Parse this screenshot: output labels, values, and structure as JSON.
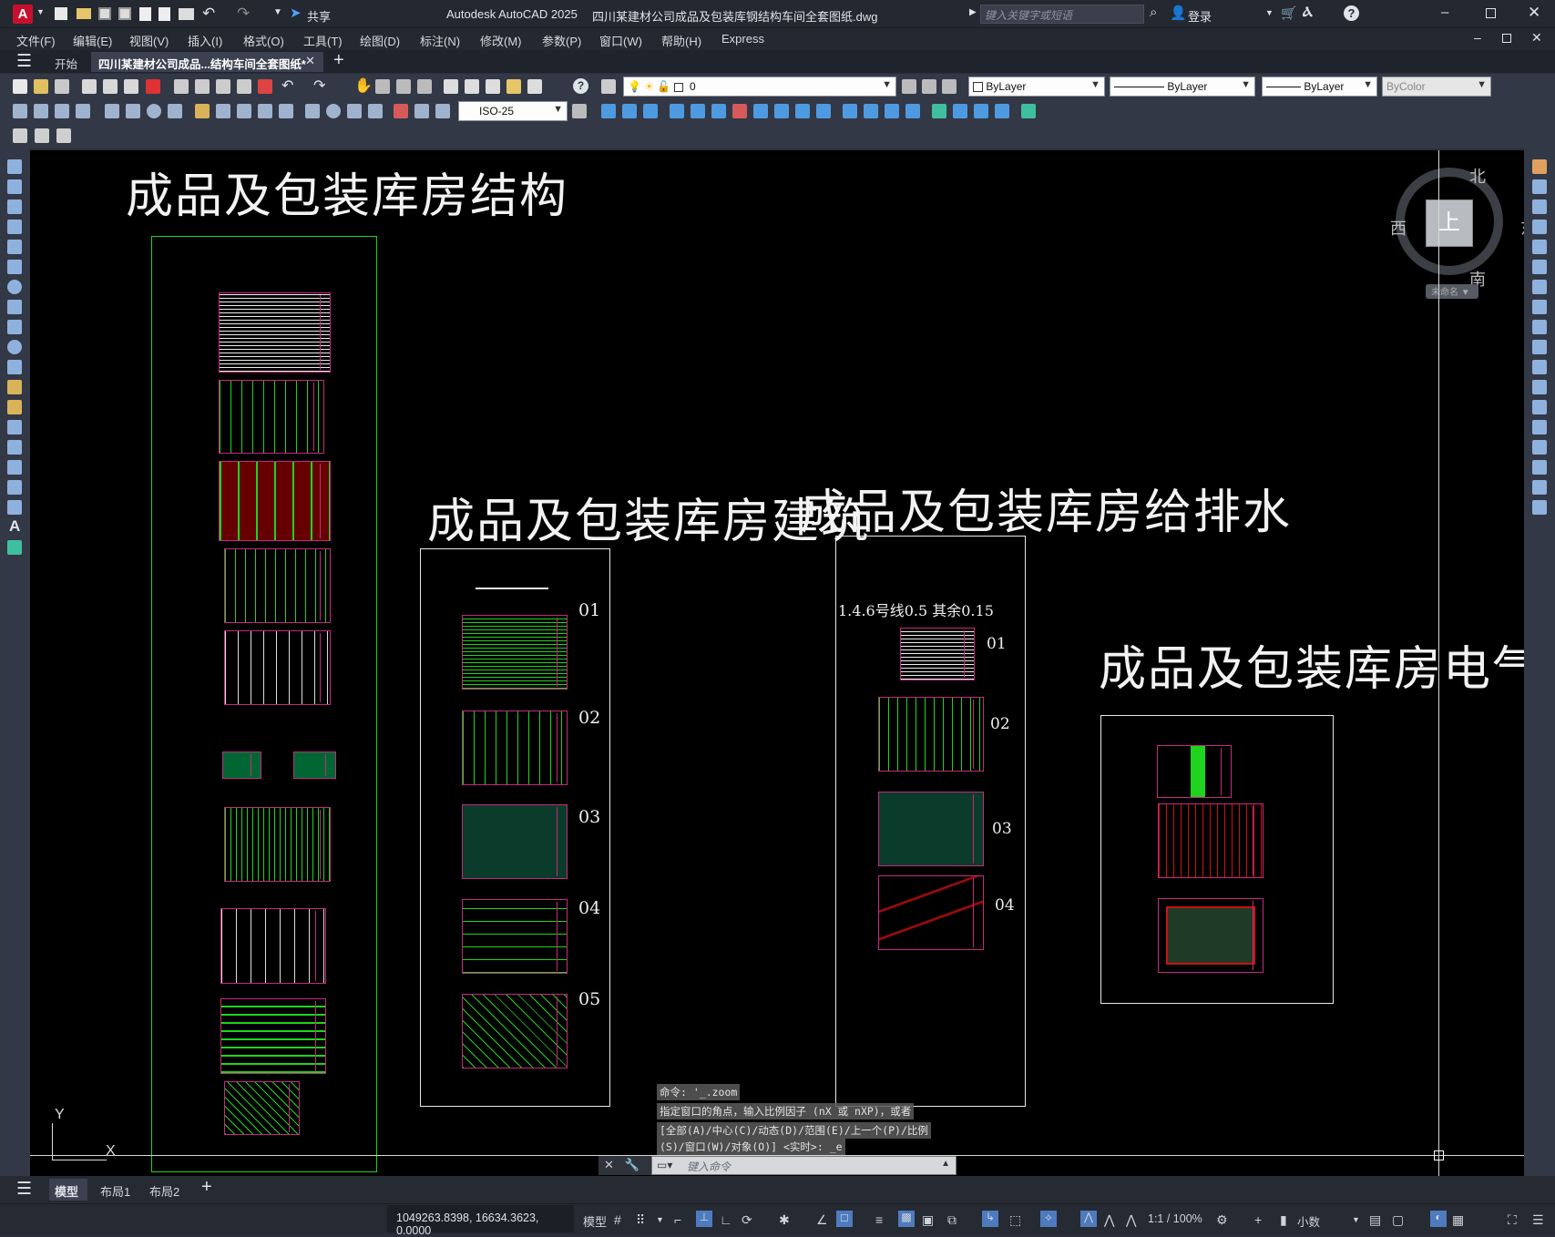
{
  "app": {
    "logo": "A",
    "title": "Autodesk AutoCAD 2025",
    "file": "四川某建材公司成品及包装库钢结构车间全套图纸.dwg",
    "share": "共享",
    "search_placeholder": "键入关键字或短语",
    "login": "登录"
  },
  "menu": [
    "文件(F)",
    "编辑(E)",
    "视图(V)",
    "插入(I)",
    "格式(O)",
    "工具(T)",
    "绘图(D)",
    "标注(N)",
    "修改(M)",
    "参数(P)",
    "窗口(W)",
    "帮助(H)",
    "Express"
  ],
  "tabs": {
    "start": "开始",
    "doc": "四川某建材公司成品...结构车间全套图纸*"
  },
  "toolbar": {
    "layer_value": "0",
    "color": "ByLayer",
    "linetype": "ByLayer",
    "lineweight": "ByLayer",
    "plotstyle": "ByColor",
    "dimstyle": "ISO-25"
  },
  "viewcube": {
    "north": "北",
    "south": "南",
    "east": "东",
    "west": "西",
    "top": "上",
    "wcs": "未命名"
  },
  "drawing": {
    "groups": [
      {
        "title": "成品及包装库房结构"
      },
      {
        "title": "成品及包装库房建筑",
        "numbers": [
          "01",
          "02",
          "03",
          "04",
          "05"
        ]
      },
      {
        "title": "成品及包装库房给排水",
        "note": "1.4.6号线0.5  其余0.15",
        "numbers": [
          "01",
          "02",
          "03",
          "04"
        ]
      },
      {
        "title": "成品及包装库房电气"
      }
    ],
    "ucs": {
      "x": "X",
      "y": "Y"
    }
  },
  "command": {
    "history": [
      "命令: '_.zoom",
      "指定窗口的角点，输入比例因子 (nX 或 nXP)，或者",
      "[全部(A)/中心(C)/动态(D)/范围(E)/上一个(P)/比例",
      "(S)/窗口(W)/对象(O)] <实时>: _e"
    ],
    "placeholder": "键入命令"
  },
  "layout_tabs": [
    "模型",
    "布局1",
    "布局2"
  ],
  "status": {
    "coords": "1049263.8398, 16634.3623, 0.0000",
    "model": "模型",
    "scale": "1:1 / 100%",
    "units": "小数"
  }
}
